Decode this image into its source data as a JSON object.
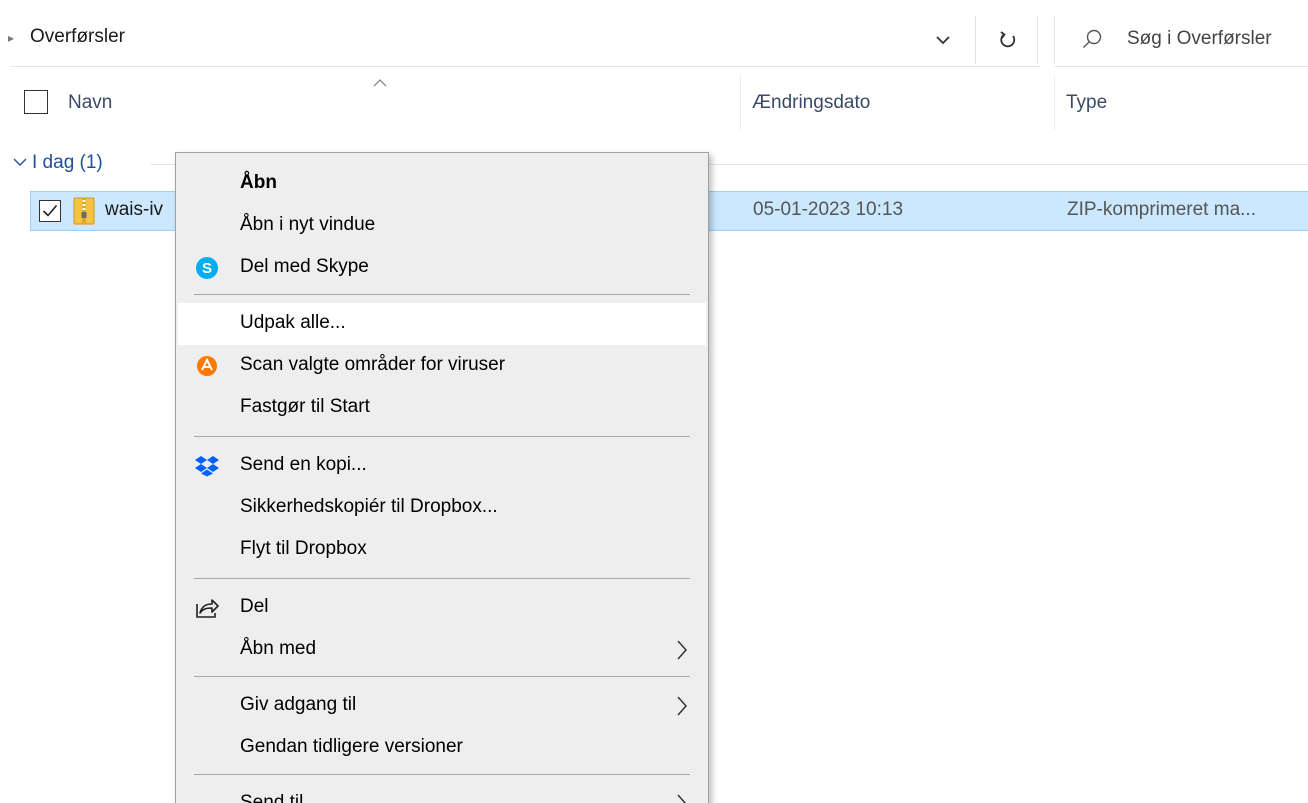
{
  "address": {
    "crumb": "Overførsler",
    "search_placeholder": "Søg i Overførsler"
  },
  "columns": {
    "name": "Navn",
    "date": "Ændringsdato",
    "type": "Type"
  },
  "group": {
    "label": "I dag (1)"
  },
  "file": {
    "name": "wais-iv",
    "date": "05-01-2023 10:13",
    "type": "ZIP-komprimeret ma..."
  },
  "menu": {
    "items": [
      {
        "label": "Åbn"
      },
      {
        "label": "Åbn i nyt vindue"
      },
      {
        "label": "Del med Skype",
        "icon": "skype-icon"
      },
      {
        "label": "Udpak alle..."
      },
      {
        "label": "Scan valgte områder for viruser",
        "icon": "avast-icon"
      },
      {
        "label": "Fastgør til Start"
      },
      {
        "label": "Send en kopi...",
        "icon": "dropbox-icon"
      },
      {
        "label": "Sikkerhedskopiér til Dropbox..."
      },
      {
        "label": "Flyt til Dropbox"
      },
      {
        "label": "Del",
        "icon": "share-icon"
      },
      {
        "label": "Åbn med"
      },
      {
        "label": "Giv adgang til"
      },
      {
        "label": "Gendan tidligere versioner"
      },
      {
        "label": "Send til"
      }
    ]
  },
  "colors": {
    "selection": "#cce8ff",
    "menu_bg": "#eeeeee",
    "skype": "#00aff0",
    "avast": "#ff7800",
    "dropbox": "#0061fe"
  }
}
